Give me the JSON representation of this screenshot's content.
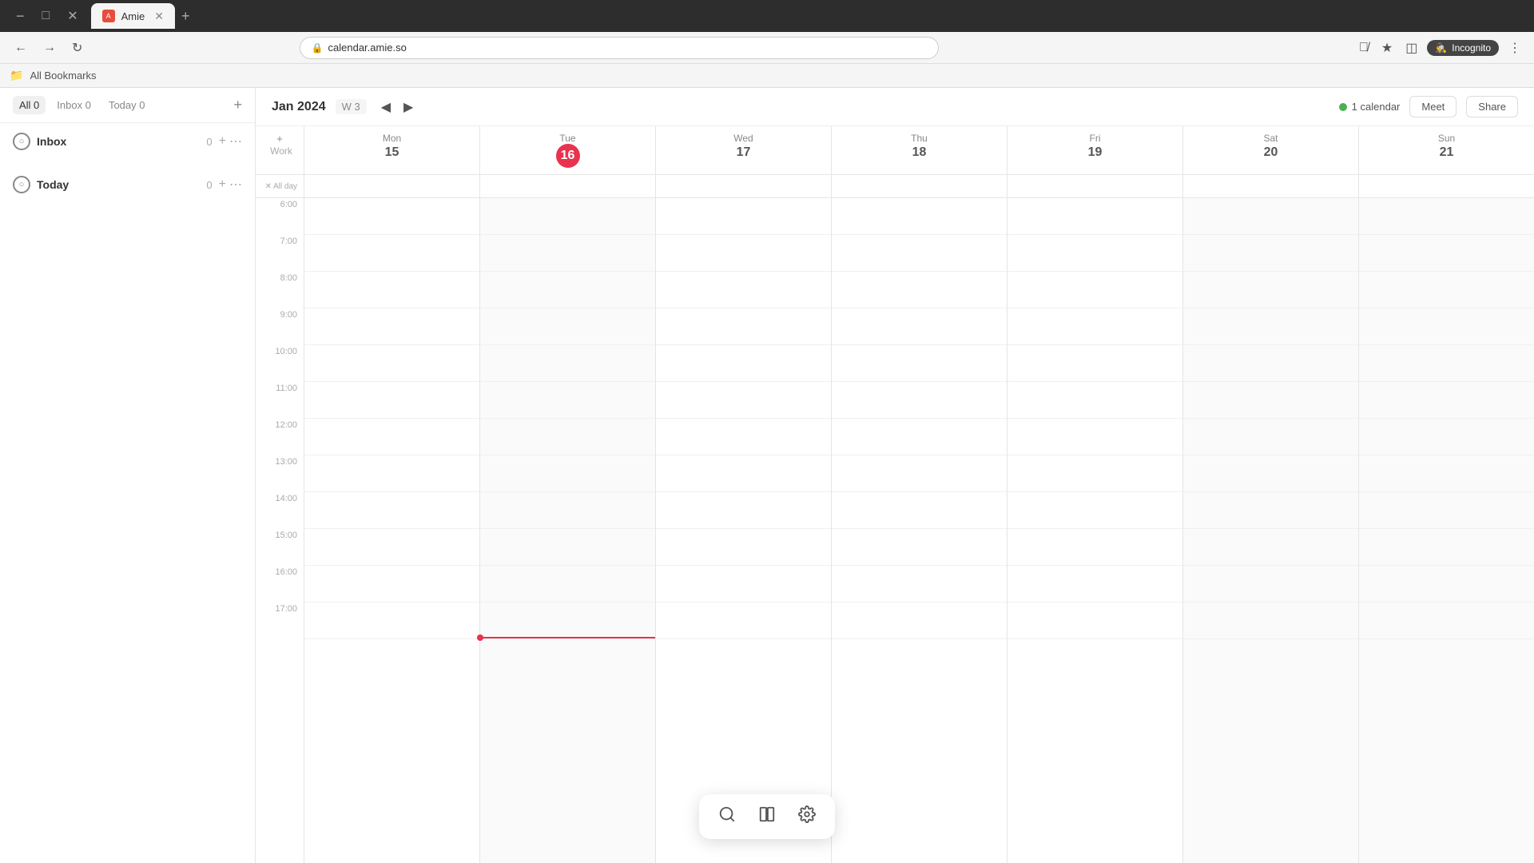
{
  "browser": {
    "tab_favicon": "A",
    "tab_title": "Amie",
    "address": "calendar.amie.so",
    "incognito_label": "Incognito",
    "bookmarks_label": "All Bookmarks"
  },
  "sidebar": {
    "filter_tabs": [
      {
        "id": "all",
        "label": "All",
        "count": "0",
        "active": true
      },
      {
        "id": "inbox",
        "label": "Inbox",
        "count": "0",
        "active": false
      },
      {
        "id": "today",
        "label": "Today",
        "count": "0",
        "active": false
      }
    ],
    "sections": [
      {
        "id": "inbox",
        "icon": "○",
        "title": "Inbox",
        "count": "0"
      },
      {
        "id": "today",
        "icon": "○",
        "title": "Today",
        "count": "0"
      }
    ]
  },
  "calendar": {
    "month_year": "Jan 2024",
    "week_label": "W 3",
    "calendar_count": "1 calendar",
    "meet_label": "Meet",
    "share_label": "Share",
    "work_label": "Work",
    "allday_label": "All day",
    "days": [
      {
        "name": "Mon",
        "num": "15",
        "today": false
      },
      {
        "name": "Tue",
        "num": "16",
        "today": true
      },
      {
        "name": "Wed",
        "num": "17",
        "today": false
      },
      {
        "name": "Thu",
        "num": "18",
        "today": false
      },
      {
        "name": "Fri",
        "num": "19",
        "today": false
      },
      {
        "name": "Sat",
        "num": "20",
        "today": false
      },
      {
        "name": "Sun",
        "num": "21",
        "today": false
      }
    ],
    "time_slots": [
      "6:00",
      "7:00",
      "8:00",
      "9:00",
      "10:00",
      "11:00",
      "12:00",
      "13:00",
      "14:00",
      "15:00",
      "16:00",
      "17:00"
    ]
  },
  "floating_toolbar": {
    "search_icon": "🔍",
    "layout_icon": "⬜",
    "settings_icon": "⚙"
  }
}
